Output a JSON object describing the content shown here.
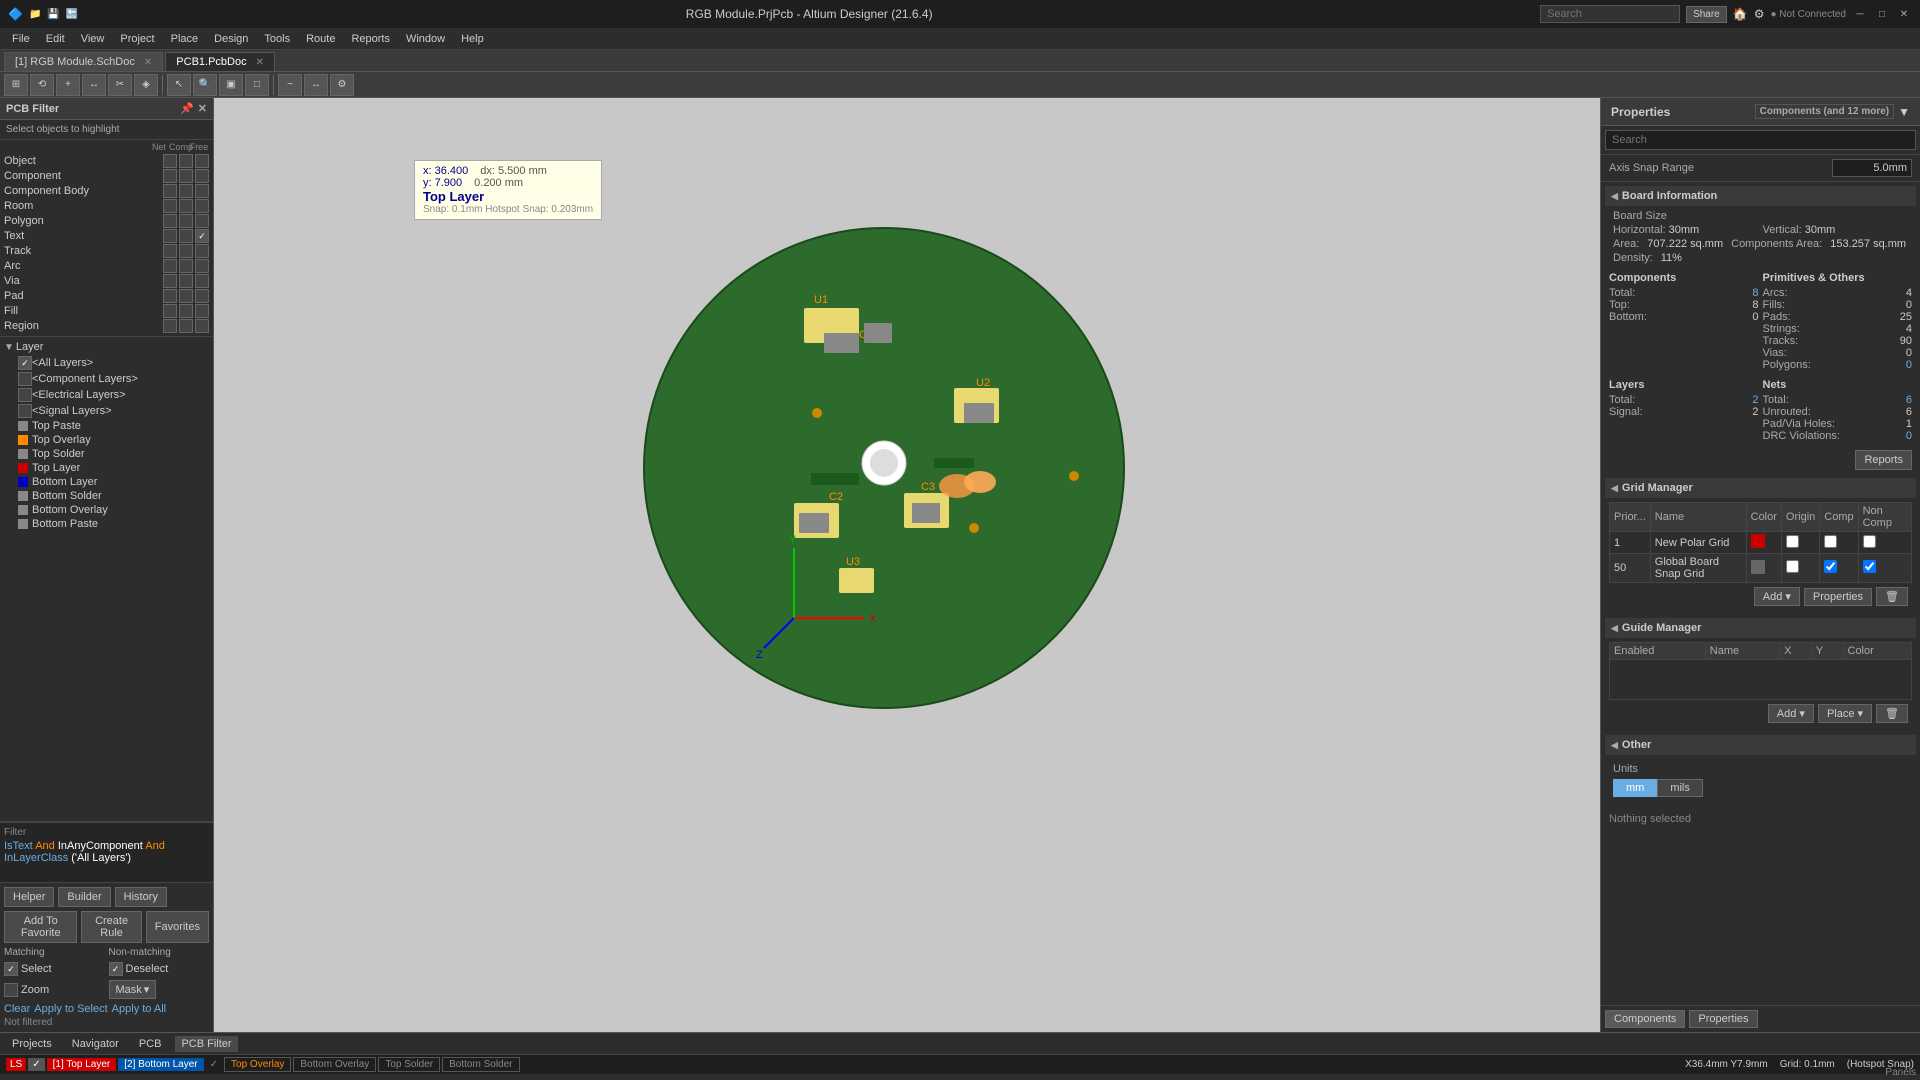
{
  "titlebar": {
    "title": "RGB Module.PrjPcb - Altium Designer (21.6.4)",
    "search_placeholder": "Search",
    "icons": [
      "share",
      "home",
      "settings",
      "not-connected"
    ]
  },
  "menubar": {
    "items": [
      "File",
      "Edit",
      "View",
      "Project",
      "Place",
      "Design",
      "Tools",
      "Route",
      "Reports",
      "Window",
      "Help"
    ]
  },
  "tabs": {
    "items": [
      {
        "label": "[1] RGB Module.SchDoc",
        "active": false
      },
      {
        "label": "PCB1.PcbDoc",
        "active": true
      }
    ]
  },
  "left_panel": {
    "title": "PCB Filter",
    "select_label": "Select objects to highlight",
    "headers": [
      "Net",
      "Comp",
      "Free"
    ],
    "filter_rows": [
      {
        "label": "Object",
        "net": false,
        "comp": false,
        "free": false
      },
      {
        "label": "Component",
        "net": false,
        "comp": false,
        "free": false
      },
      {
        "label": "Component Body",
        "net": false,
        "comp": false,
        "free": false
      },
      {
        "label": "Room",
        "net": false,
        "comp": false,
        "free": false
      },
      {
        "label": "Polygon",
        "net": false,
        "comp": false,
        "free": false
      },
      {
        "label": "Text",
        "net": false,
        "comp": false,
        "free": true
      },
      {
        "label": "Track",
        "net": false,
        "comp": false,
        "free": false
      },
      {
        "label": "Arc",
        "net": false,
        "comp": false,
        "free": false
      },
      {
        "label": "Via",
        "net": false,
        "comp": false,
        "free": false
      },
      {
        "label": "Pad",
        "net": false,
        "comp": false,
        "free": false
      },
      {
        "label": "Fill",
        "net": false,
        "comp": false,
        "free": false
      },
      {
        "label": "Region",
        "net": false,
        "comp": false,
        "free": false
      }
    ],
    "layer_header": "Layer",
    "layers": [
      {
        "label": "<All Layers>",
        "color": "#888",
        "checked": true
      },
      {
        "label": "<Component Layers>",
        "color": "#888",
        "checked": false
      },
      {
        "label": "<Electrical Layers>",
        "color": "#888",
        "checked": false
      },
      {
        "label": "<Signal Layers>",
        "color": "#888",
        "checked": false
      },
      {
        "label": "Top Paste",
        "color": "#888"
      },
      {
        "label": "Top Overlay",
        "color": "#ff8c00"
      },
      {
        "label": "Top Solder",
        "color": "#888"
      },
      {
        "label": "Top Layer",
        "color": "#cc0000"
      },
      {
        "label": "Bottom Layer",
        "color": "#0000cc"
      },
      {
        "label": "Bottom Solder",
        "color": "#888"
      },
      {
        "label": "Bottom Overlay",
        "color": "#888"
      },
      {
        "label": "Bottom Paste",
        "color": "#888"
      }
    ],
    "filter_text": {
      "line1": "IsText And InAnyComponent And",
      "line2": "InLayerClass('All Layers')"
    },
    "buttons": {
      "helper": "Helper",
      "builder": "Builder",
      "history": "History"
    },
    "favorites": {
      "add": "Add To Favorite",
      "create": "Create Rule",
      "label": "Favorites"
    },
    "matching": {
      "header_match": "Matching",
      "header_nonmatch": "Non-matching",
      "select": "Select",
      "deselect": "Deselect",
      "zoom": "Zoom",
      "mask": "Mask"
    },
    "actions": {
      "clear": "Clear",
      "apply_to_select": "Apply to Select",
      "apply_to_all": "Apply to All"
    },
    "not_filtered": "Not filtered"
  },
  "tooltip": {
    "dx": "dx: 5.500 mm",
    "dy": "0.200 mm",
    "x": "x: 36.400",
    "y": "y: 7.900",
    "layer": "Top Layer",
    "snap": "Snap: 0.1mm Hotspot Snap: 0.203mm"
  },
  "right_panel": {
    "title": "Properties",
    "filter_label": "Components (and 12 more)",
    "search_placeholder": "Search",
    "axis_snap_label": "Axis Snap Range",
    "axis_snap_value": "5.0mm",
    "board_info": {
      "section": "Board Information",
      "board_size": "Board Size",
      "horizontal_label": "Horizontal:",
      "horizontal_value": "30mm",
      "vertical_label": "Vertical:",
      "vertical_value": "30mm",
      "area_label": "Area:",
      "area_value": "707.222 sq.mm",
      "comp_area_label": "Components Area:",
      "comp_area_value": "153.257 sq.mm",
      "density_label": "Density:",
      "density_value": "11%"
    },
    "components": {
      "section": "Components",
      "total_label": "Total:",
      "total_value": "8",
      "top_label": "Top:",
      "top_value": "8",
      "bottom_label": "Bottom:",
      "bottom_value": "0"
    },
    "primitives": {
      "section": "Primitives & Others",
      "arcs_label": "Arcs:",
      "arcs_value": "4",
      "fills_label": "Fills:",
      "fills_value": "0",
      "pads_label": "Pads:",
      "pads_value": "25",
      "strings_label": "Strings:",
      "strings_value": "4",
      "tracks_label": "Tracks:",
      "tracks_value": "90",
      "vias_label": "Vias:",
      "vias_value": "0",
      "polygons_label": "Polygons:",
      "polygons_value": "0"
    },
    "layers": {
      "section": "Layers",
      "total_label": "Total:",
      "total_value": "2",
      "signal_label": "Signal:",
      "signal_value": "2"
    },
    "nets": {
      "section": "Nets",
      "total_label": "Total:",
      "total_value": "6",
      "unrouted_label": "Unrouted:",
      "unrouted_value": "6",
      "pad_via_label": "Pad/Via Holes:",
      "pad_via_value": "1",
      "drc_label": "DRC Violations:",
      "drc_value": "0"
    },
    "reports_btn": "Reports",
    "grid_manager": {
      "section": "Grid Manager",
      "columns": [
        "Prior...",
        "Name",
        "Color",
        "Origin",
        "Comp",
        "Non Comp"
      ],
      "rows": [
        {
          "priority": "1",
          "name": "New Polar Grid",
          "color": "#cc0000",
          "origin": false,
          "comp": false,
          "non_comp": false
        },
        {
          "priority": "50",
          "name": "Global Board Snap Grid",
          "color": "#444",
          "origin": false,
          "comp": true,
          "non_comp": true
        }
      ],
      "add_btn": "Add",
      "props_btn": "Properties",
      "delete_icon": "×"
    },
    "guide_manager": {
      "section": "Guide Manager",
      "columns": [
        "Enabled",
        "Name",
        "X",
        "Y",
        "Color"
      ],
      "add_btn": "Add",
      "place_btn": "Place",
      "delete_icon": "×"
    },
    "other": {
      "section": "Other",
      "units_label": "Units",
      "unit_mm": "mm",
      "unit_mils": "mils"
    },
    "nothing_selected": "Nothing selected",
    "footer_tabs": [
      "Components",
      "Properties"
    ]
  },
  "bottom_tabs": [
    "Projects",
    "Navigator",
    "PCB",
    "PCB Filter"
  ],
  "statusbar": {
    "x": "X36.4mm",
    "y": "Y7.9mm",
    "grid": "Grid: 0.1mm",
    "hotsnap": "(Hotspot Snap)",
    "layers": [
      {
        "label": "LS",
        "color": "#cc0000"
      },
      {
        "label": "[1] Top Layer",
        "color": "#cc0000",
        "text_color": "#fff"
      },
      {
        "label": "[2] Bottom Layer",
        "color": "#0000cc",
        "text_color": "#fff"
      },
      {
        "label": "Top Overlay",
        "color": "#ff8c00"
      },
      {
        "label": "Bottom Overlay",
        "color": "#888888"
      },
      {
        "label": "Top Solder",
        "color": "#888888"
      },
      {
        "label": "Bottom Solder",
        "color": "#888888"
      }
    ]
  },
  "canvas_toolbar": {
    "buttons": [
      "filter",
      "route",
      "plus",
      "connect",
      "cut",
      "highlight",
      "cursor",
      "search",
      "component",
      "rect",
      "trace",
      "measure",
      "settings"
    ]
  }
}
